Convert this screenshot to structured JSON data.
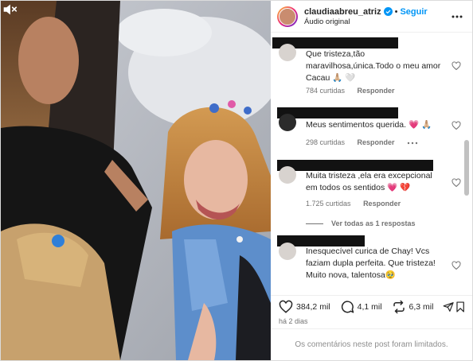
{
  "header": {
    "username": "claudiaabreu_atriz",
    "follow_label": "Seguir",
    "subtitle": "Áudio original",
    "separator": "•"
  },
  "comments": [
    {
      "text": "Que tristeza,tão maravilhosa,única.Todo o meu amor Cacau 🙏🏼 🤍",
      "likes": "784 curtidas",
      "reply_label": "Responder"
    },
    {
      "text": "Meus sentimentos querida. 💗 🙏🏼",
      "likes": "298 curtidas",
      "reply_label": "Responder"
    },
    {
      "text": "Muita tristeza ,ela era excepcional em todos os sentidos 💗 💔",
      "likes": "1.725 curtidas",
      "reply_label": "Responder",
      "view_replies": "Ver todas as 1 respostas"
    },
    {
      "text": "Inesquecível curica de Chay! Vcs faziam dupla perfeita. Que tristeza! Muito nova, talentosa🥹"
    }
  ],
  "actions": {
    "likes": "384,2 mil",
    "comments": "4,1 mil",
    "shares": "6,3 mil"
  },
  "post_date": "há 2 dias",
  "limited_text": "Os comentários neste post foram limitados.",
  "colors": {
    "accent": "#0095f6",
    "muted": "#737373",
    "redaction": "#121212"
  }
}
